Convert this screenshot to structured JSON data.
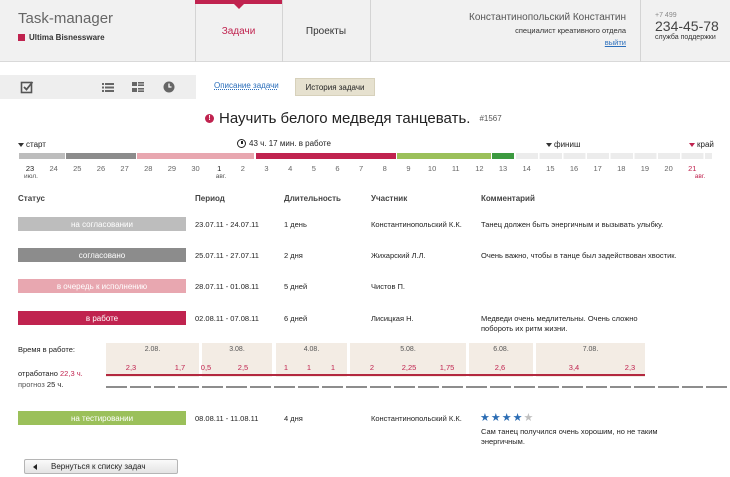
{
  "header": {
    "app_title": "Task-manager",
    "company": "Ultima Bisnessware",
    "nav": [
      {
        "label": "Задачи",
        "active": true
      },
      {
        "label": "Проекты",
        "active": false
      }
    ],
    "user": {
      "name": "Константинопольский Константин",
      "role": "специалист креативного отдела",
      "logout": "выйти"
    },
    "support": {
      "code": "+7 499",
      "phone": "234-45-78",
      "label": "служба поддержки"
    }
  },
  "toolbar": {
    "icons": [
      "checkbox-icon",
      "list-icon",
      "grid-list-icon",
      "clock-icon"
    ],
    "tab_description": "Описание задачи",
    "tab_history": "История задачи"
  },
  "task": {
    "title": "Научить белого медведя танцевать.",
    "number": "#1567",
    "alert_glyph": "!"
  },
  "timeline": {
    "start_label": "старт",
    "finish_label": "финиш",
    "edge_label": "край",
    "in_work_label": "43 ч. 17 мин. в работе",
    "days": [
      "23",
      "24",
      "25",
      "26",
      "27",
      "28",
      "29",
      "30",
      "1",
      "2",
      "3",
      "4",
      "5",
      "6",
      "7",
      "8",
      "9",
      "10",
      "11",
      "12",
      "13",
      "14",
      "15",
      "16",
      "17",
      "18",
      "19",
      "20",
      "21"
    ],
    "month_july": "июл.",
    "month_aug_1": "авг.",
    "month_aug_21": "авг.",
    "colors": {
      "grey_light": "#bdbdbd",
      "grey_dark": "#8c8c8c",
      "pink": "#e8a7b0",
      "crimson": "#c0234f",
      "green_light": "#9bc05a",
      "green_dark": "#3c9a3f",
      "future": "#ececec"
    }
  },
  "table": {
    "headers": {
      "status": "Статус",
      "period": "Период",
      "duration": "Длительность",
      "participant": "Участник",
      "comment": "Комментарий"
    },
    "rows": [
      {
        "status": "на согласовании",
        "color": "#bdbdbd",
        "period": "23.07.11 - 24.07.11",
        "duration": "1 день",
        "participant": "Константинопольский К.К.",
        "comment": "Танец должен быть энергичным и вызывать улыбку."
      },
      {
        "status": "согласовано",
        "color": "#8c8c8c",
        "period": "25.07.11 - 27.07.11",
        "duration": "2 дня",
        "participant": "Жихарский Л.Л.",
        "comment": "Очень важно, чтобы в танце был задействован хвостик."
      },
      {
        "status": "в очередь к исполнению",
        "color": "#e8a7b0",
        "period": "28.07.11 - 01.08.11",
        "duration": "5 дней",
        "participant": "Чистов П.",
        "comment": ""
      },
      {
        "status": "в работе",
        "color": "#c0234f",
        "period": "02.08.11 - 07.08.11",
        "duration": "6 дней",
        "participant": "Лисицкая Н.",
        "comment": "Медведи очень медлительны. Очень сложно побороть их ритм жизни."
      },
      {
        "status": "на тестировании",
        "color": "#9bc05a",
        "period": "08.08.11 - 11.08.11",
        "duration": "4 дня",
        "participant": "Константинопольский К.К.",
        "comment": "Сам танец получился очень хорошим, но не таким энергичным."
      }
    ]
  },
  "work_time": {
    "label": "Время в работе:",
    "worked_label": "отработано",
    "worked_value": "22,3 ч.",
    "forecast_label": "прогноз",
    "forecast_value": "25 ч.",
    "days": [
      "2.08.",
      "3.08.",
      "4.08.",
      "5.08.",
      "6.08.",
      "7.08."
    ],
    "values": [
      "2,3",
      "1,7",
      "0,5",
      "2,5",
      "1",
      "1",
      "1",
      "2",
      "2,25",
      "1,75",
      "2,6",
      "3,4",
      "2,3"
    ]
  },
  "rating": {
    "value": 4,
    "max": 5
  },
  "back_button": "Вернуться к списку задач"
}
